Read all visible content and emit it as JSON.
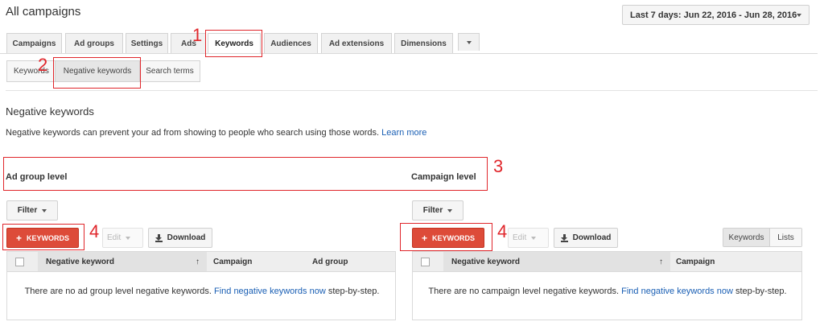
{
  "page": {
    "title": "All campaigns"
  },
  "date_range": {
    "label": "Last 7 days: Jun 22, 2016 - Jun 28, 2016"
  },
  "tabs": [
    {
      "label": "Campaigns"
    },
    {
      "label": "Ad groups"
    },
    {
      "label": "Settings"
    },
    {
      "label": "Ads"
    },
    {
      "label": "Keywords"
    },
    {
      "label": "Audiences"
    },
    {
      "label": "Ad extensions"
    },
    {
      "label": "Dimensions"
    }
  ],
  "subtabs": [
    {
      "label": "Keywords"
    },
    {
      "label": "Negative keywords"
    },
    {
      "label": "Search terms"
    }
  ],
  "section": {
    "title": "Negative keywords",
    "description": "Negative keywords can prevent your ad from showing to people who search using those words.",
    "learn_more": "Learn more"
  },
  "ad_group_panel": {
    "title": "Ad group level",
    "filter": "Filter",
    "add_keywords": "KEYWORDS",
    "edit": "Edit",
    "download": "Download",
    "columns": [
      "Negative keyword",
      "Campaign",
      "Ad group"
    ],
    "empty_text": "There are no ad group level negative keywords.",
    "empty_link": "Find negative keywords now",
    "empty_suffix": "step-by-step."
  },
  "campaign_panel": {
    "title": "Campaign level",
    "filter": "Filter",
    "add_keywords": "KEYWORDS",
    "edit": "Edit",
    "download": "Download",
    "toggle": [
      "Keywords",
      "Lists"
    ],
    "columns": [
      "Negative keyword",
      "Campaign"
    ],
    "empty_text": "There are no campaign level negative keywords.",
    "empty_link": "Find negative keywords now",
    "empty_suffix": "step-by-step."
  },
  "annotations": [
    "1",
    "2",
    "3",
    "4",
    "4"
  ],
  "colors": {
    "annotation": "#e0262b",
    "primary_button": "#dd4b39",
    "link": "#1a5fb4"
  },
  "icons": {
    "sort": "arrow-up-icon",
    "download": "download-icon",
    "add": "plus-icon",
    "dropdown": "chevron-down-icon"
  }
}
